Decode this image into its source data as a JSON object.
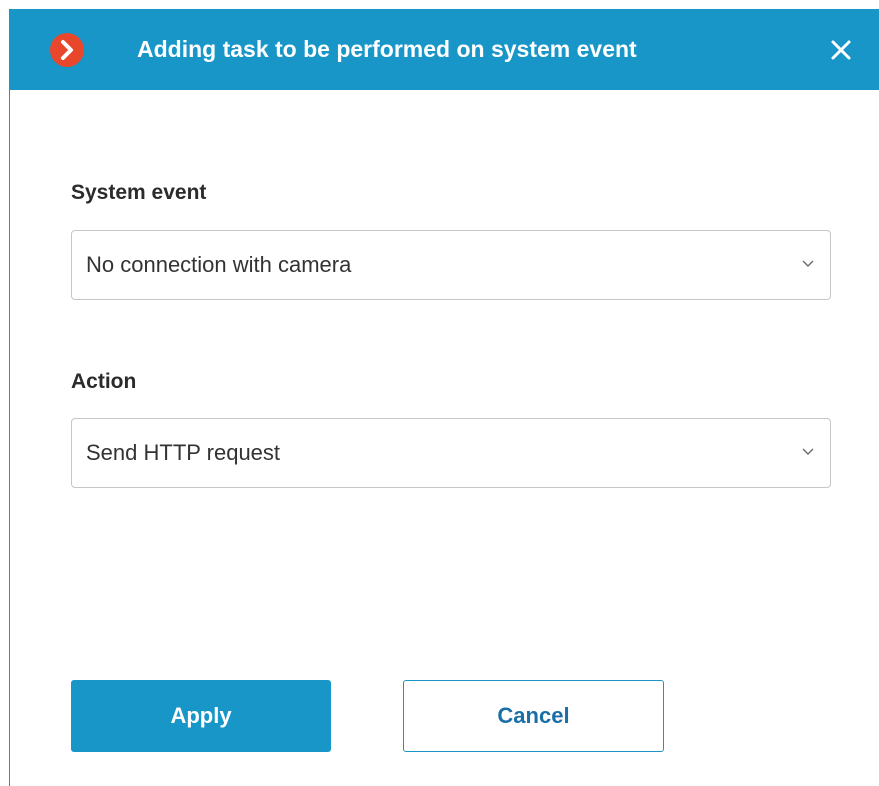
{
  "dialog": {
    "title": "Adding task to be performed on system event",
    "logo_icon": "app-logo-icon",
    "close_icon": "close-icon",
    "accent_color": "#1996c8",
    "logo_color": "#e8472b"
  },
  "form": {
    "system_event": {
      "label": "System event",
      "value": "No connection with camera",
      "icon": "chevron-down-icon"
    },
    "action": {
      "label": "Action",
      "value": "Send HTTP request",
      "icon": "chevron-down-icon"
    }
  },
  "buttons": {
    "apply_label": "Apply",
    "cancel_label": "Cancel"
  }
}
